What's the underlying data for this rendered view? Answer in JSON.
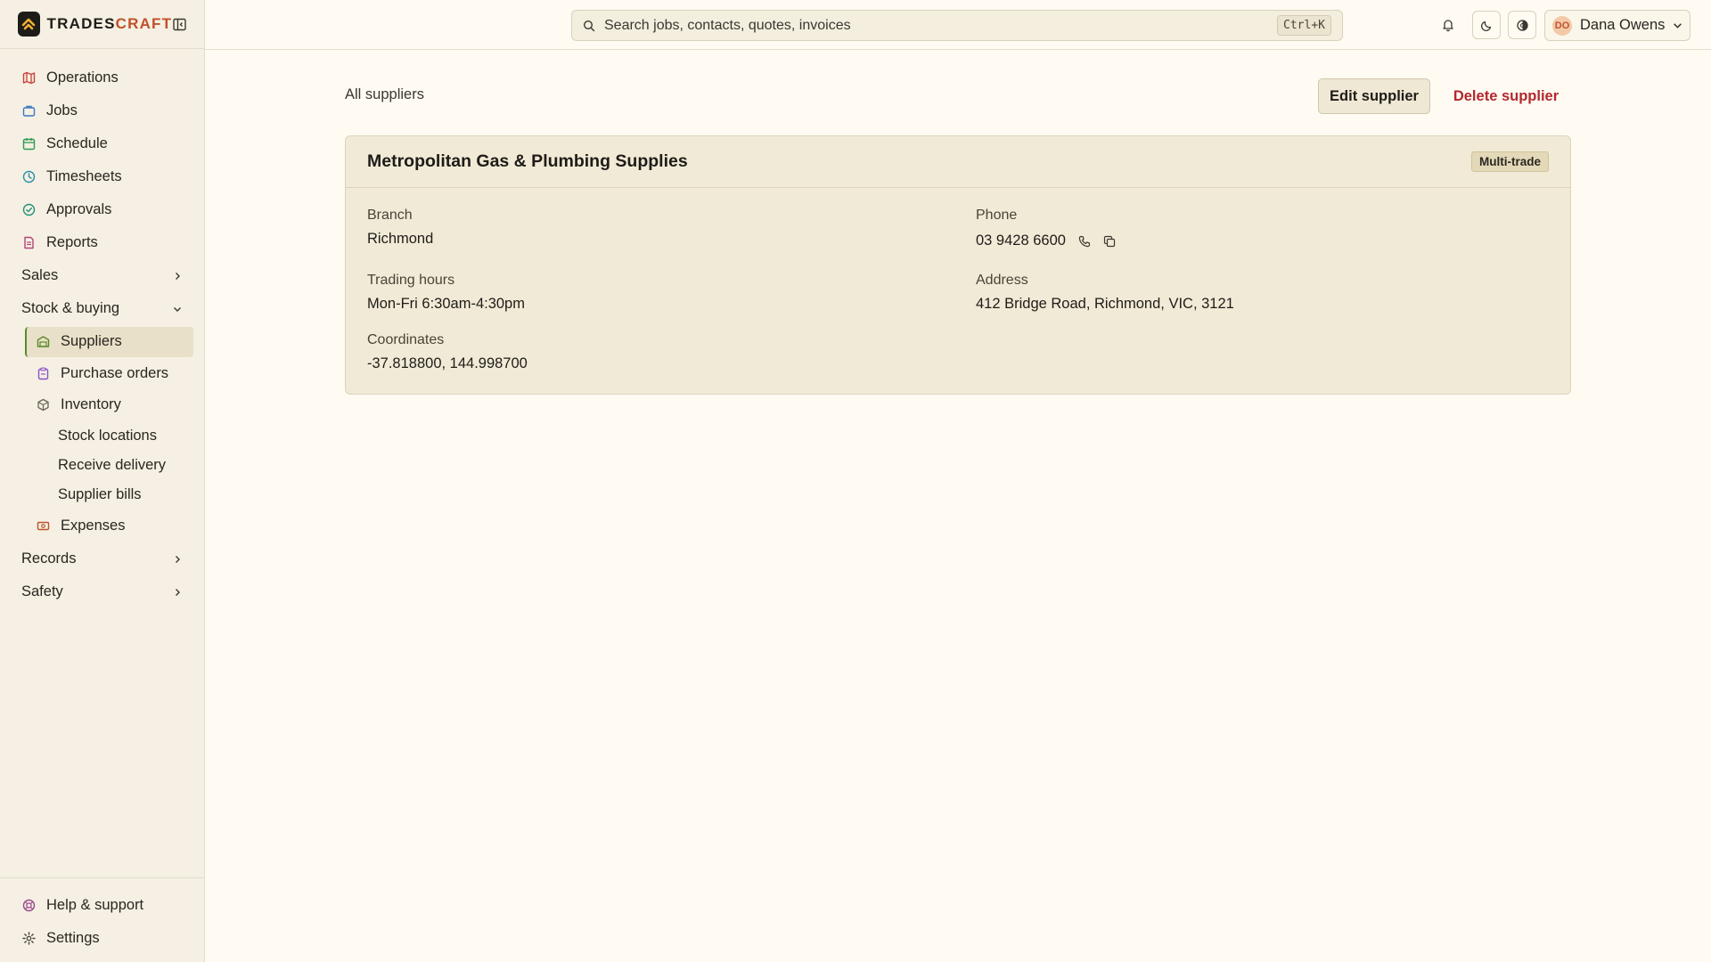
{
  "brand": {
    "name_main": "TRADES",
    "name_accent": "CRAFT"
  },
  "colors": {
    "accent": "#c2502a",
    "active_bar": "#5b8a28",
    "danger": "#b3272f"
  },
  "sidebar": {
    "items": [
      {
        "label": "Operations",
        "icon": "map-icon"
      },
      {
        "label": "Jobs",
        "icon": "briefcase-icon"
      },
      {
        "label": "Schedule",
        "icon": "calendar-icon"
      },
      {
        "label": "Timesheets",
        "icon": "clock-icon"
      },
      {
        "label": "Approvals",
        "icon": "check-circle-icon"
      },
      {
        "label": "Reports",
        "icon": "document-icon"
      }
    ],
    "groups": {
      "sales": "Sales",
      "stock": "Stock & buying",
      "records": "Records",
      "safety": "Safety"
    },
    "stock_items": {
      "suppliers": "Suppliers",
      "purchase_orders": "Purchase orders",
      "inventory": "Inventory",
      "stock_locations": "Stock locations",
      "receive_delivery": "Receive delivery",
      "supplier_bills": "Supplier bills",
      "expenses": "Expenses"
    },
    "bottom": {
      "help": "Help & support",
      "settings": "Settings"
    }
  },
  "topbar": {
    "search_placeholder": "Search jobs, contacts, quotes, invoices",
    "search_shortcut": "Ctrl+K",
    "user": {
      "initials": "DO",
      "name": "Dana Owens"
    }
  },
  "page": {
    "back_link": "All suppliers",
    "edit_label": "Edit supplier",
    "delete_label": "Delete supplier"
  },
  "supplier": {
    "name": "Metropolitan Gas & Plumbing Supplies",
    "badge": "Multi-trade",
    "branch_label": "Branch",
    "branch": "Richmond",
    "hours_label": "Trading hours",
    "hours": "Mon-Fri 6:30am-4:30pm",
    "coords_label": "Coordinates",
    "coords": "-37.818800, 144.998700",
    "phone_label": "Phone",
    "phone": "03 9428 6600",
    "address_label": "Address",
    "address": "412 Bridge Road, Richmond, VIC, 3121"
  }
}
